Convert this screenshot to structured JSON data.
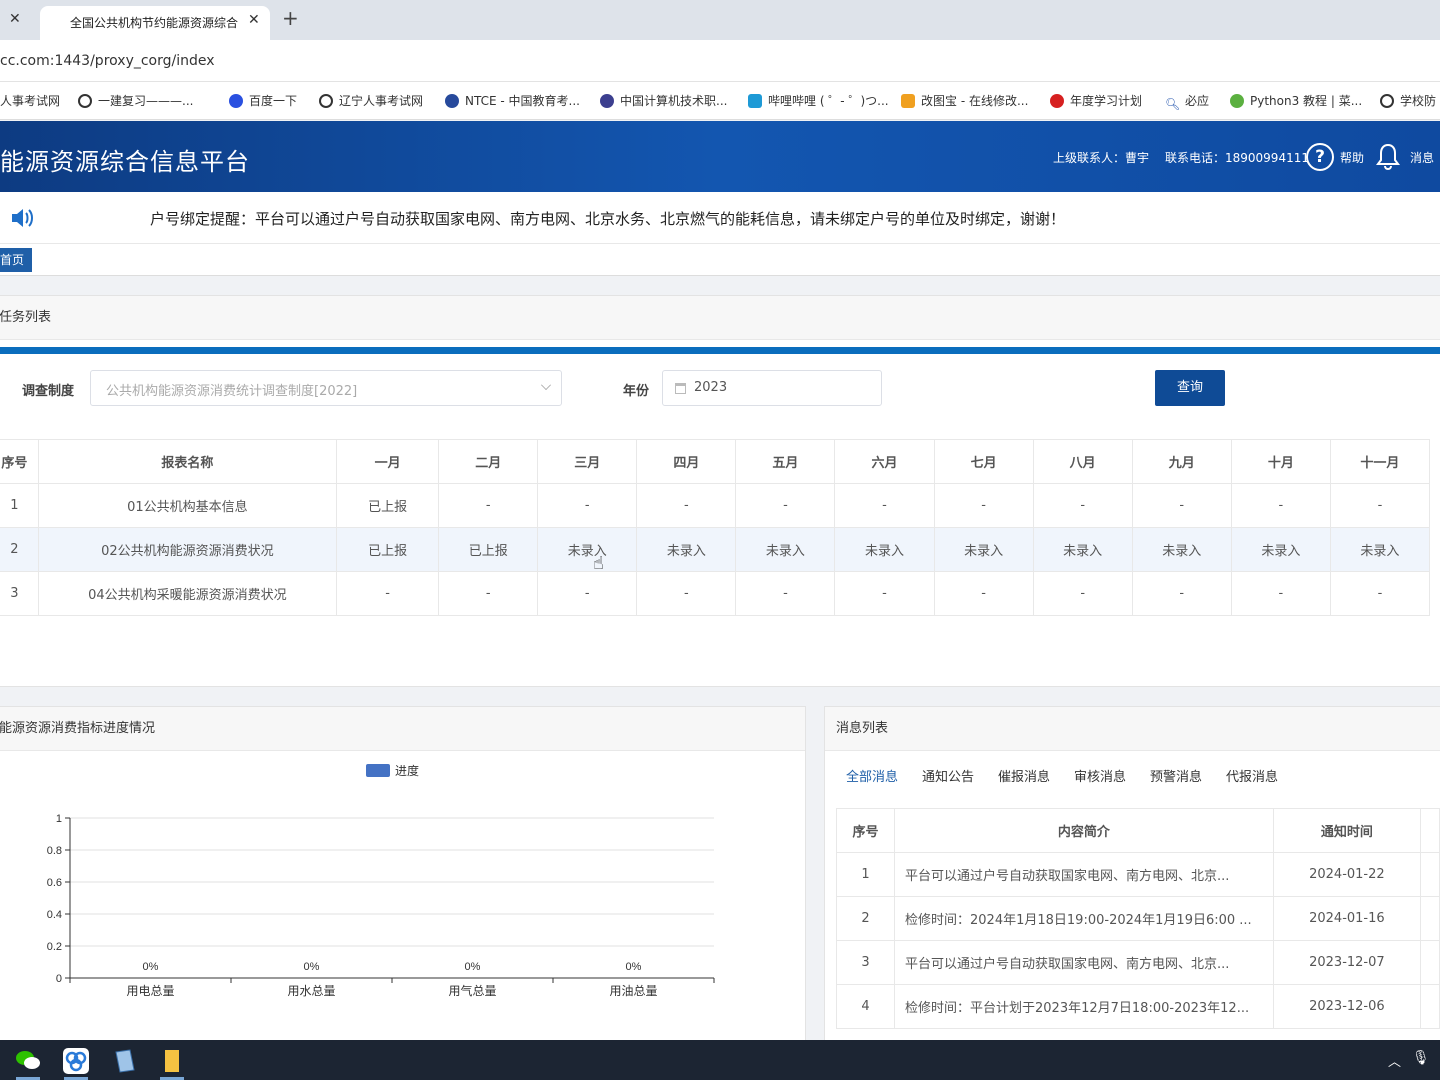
{
  "browser": {
    "tab_title": "全国公共机构节约能源资源综合",
    "url": "cc.com:1443/proxy_corg/index",
    "bookmarks": [
      "人事考试网",
      "一建复习———...",
      "百度一下",
      "辽宁人事考试网",
      "NTCE - 中国教育考...",
      "中国计算机技术职...",
      "哔哩哔哩 ( ゜- ゜)つ...",
      "改图宝 - 在线修改...",
      "年度学习计划",
      "必应",
      "Python3 教程 | 菜...",
      "学校防"
    ]
  },
  "header": {
    "title": "能源资源综合信息平台",
    "contact_label": "上级联系人：曹宇",
    "phone_label": "联系电话：18900994111",
    "help_label": "帮助",
    "msg_label": "消息"
  },
  "notice": "户号绑定提醒：平台可以通过户号自动获取国家电网、南方电网、北京水务、北京燃气的能耗信息，请未绑定户号的单位及时绑定，谢谢！",
  "breadcrumb": "首页",
  "task_panel": {
    "title": "任务列表",
    "survey_label": "调查制度",
    "survey_value": "公共机构能源资源消费统计调查制度[2022]",
    "year_label": "年份",
    "year_value": "2023",
    "query_button": "查询",
    "columns": [
      "序号",
      "报表名称",
      "一月",
      "二月",
      "三月",
      "四月",
      "五月",
      "六月",
      "七月",
      "八月",
      "九月",
      "十月",
      "十一月"
    ],
    "rows": [
      [
        "1",
        "01公共机构基本信息",
        "已上报",
        "-",
        "-",
        "-",
        "-",
        "-",
        "-",
        "-",
        "-",
        "-",
        "-"
      ],
      [
        "2",
        "02公共机构能源资源消费状况",
        "已上报",
        "已上报",
        "未录入",
        "未录入",
        "未录入",
        "未录入",
        "未录入",
        "未录入",
        "未录入",
        "未录入",
        "未录入"
      ],
      [
        "3",
        "04公共机构采暖能源资源消费状况",
        "-",
        "-",
        "-",
        "-",
        "-",
        "-",
        "-",
        "-",
        "-",
        "-",
        "-"
      ]
    ]
  },
  "progress_panel": {
    "title": "能源资源消费指标进度情况"
  },
  "chart_data": {
    "type": "bar",
    "categories": [
      "用电总量",
      "用水总量",
      "用气总量",
      "用油总量"
    ],
    "series": [
      {
        "name": "进度",
        "values": [
          0,
          0,
          0,
          0
        ],
        "color": "#4472c4"
      }
    ],
    "data_labels": [
      "0%",
      "0%",
      "0%",
      "0%"
    ],
    "y_ticks": [
      "0",
      "0.2",
      "0.4",
      "0.6",
      "0.8",
      "1"
    ],
    "ylim": [
      0,
      1
    ],
    "legend": "top-center",
    "grid": true
  },
  "message_panel": {
    "title": "消息列表",
    "tabs": [
      "全部消息",
      "通知公告",
      "催报消息",
      "审核消息",
      "预警消息",
      "代报消息"
    ],
    "active_color": "#1f5fa8",
    "columns": [
      "序号",
      "内容简介",
      "通知时间"
    ],
    "rows": [
      [
        "1",
        "平台可以通过户号自动获取国家电网、南方电网、北京...",
        "2024-01-22"
      ],
      [
        "2",
        "检修时间：2024年1月18日19:00-2024年1月19日6:00 ...",
        "2024-01-16"
      ],
      [
        "3",
        "平台可以通过户号自动获取国家电网、南方电网、北京...",
        "2023-12-07"
      ],
      [
        "4",
        "检修时间：平台计划于2023年12月7日18:00-2023年12...",
        "2023-12-06"
      ]
    ]
  }
}
